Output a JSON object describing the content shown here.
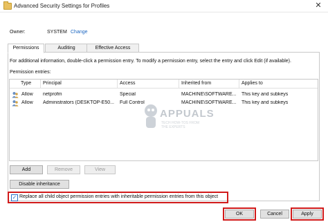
{
  "window": {
    "title": "Advanced Security Settings for Profiles",
    "close_glyph": "✕"
  },
  "owner": {
    "label": "Owner:",
    "value": "SYSTEM",
    "change_link": "Change"
  },
  "tabs": [
    {
      "label": "Permissions",
      "active": true
    },
    {
      "label": "Auditing",
      "active": false
    },
    {
      "label": "Effective Access",
      "active": false
    }
  ],
  "info_text": "For additional information, double-click a permission entry. To modify a permission entry, select the entry and click Edit (if available).",
  "entries_label": "Permission entries:",
  "table": {
    "columns": [
      "Type",
      "Principal",
      "Access",
      "Inherited from",
      "Applies to"
    ],
    "rows": [
      {
        "type": "Allow",
        "principal": "netprofm",
        "access": "Special",
        "inherited_from": "MACHINE\\SOFTWARE...",
        "applies_to": "This key and subkeys"
      },
      {
        "type": "Allow",
        "principal": "Administrators (DESKTOP-E50...",
        "access": "Full Control",
        "inherited_from": "MACHINE\\SOFTWARE...",
        "applies_to": "This key and subkeys"
      }
    ]
  },
  "watermark": {
    "text": "APPUALS",
    "subtext": "TECH HOW-TOS FROM THE EXPERTS"
  },
  "buttons": {
    "add": "Add",
    "remove": "Remove",
    "view": "View",
    "disable_inheritance": "Disable inheritance",
    "ok": "OK",
    "cancel": "Cancel",
    "apply": "Apply"
  },
  "replace_checkbox": {
    "label": "Replace all child object permission entries with inheritable permission entries from this object",
    "checked": true,
    "check_glyph": "✓"
  },
  "colors": {
    "highlight": "#d11a1a",
    "link": "#1a65c0",
    "accent": "#2a6fc9"
  }
}
